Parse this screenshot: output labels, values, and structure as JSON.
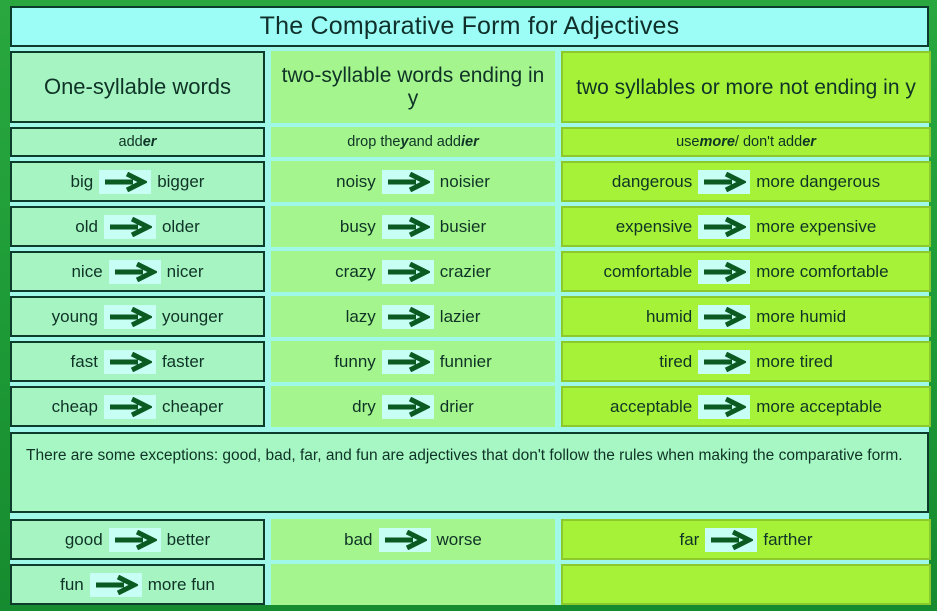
{
  "title": "The Comparative Form for Adjectives",
  "columns": [
    {
      "header": "One-syllable words",
      "rule_parts": [
        "add ",
        "er",
        ""
      ],
      "rows": [
        {
          "base": "big",
          "comparative": "bigger"
        },
        {
          "base": "old",
          "comparative": "older"
        },
        {
          "base": "nice",
          "comparative": "nicer"
        },
        {
          "base": "young",
          "comparative": "younger"
        },
        {
          "base": "fast",
          "comparative": "faster"
        },
        {
          "base": "cheap",
          "comparative": "cheaper"
        }
      ],
      "exception_rows": [
        {
          "base": "good",
          "comparative": "better"
        },
        {
          "base": "fun",
          "comparative": "more fun"
        }
      ]
    },
    {
      "header": "two-syllable words ending in y",
      "rule_parts": [
        "drop the ",
        "y",
        " and add ",
        "ier"
      ],
      "rows": [
        {
          "base": "noisy",
          "comparative": "noisier"
        },
        {
          "base": "busy",
          "comparative": "busier"
        },
        {
          "base": "crazy",
          "comparative": "crazier"
        },
        {
          "base": "lazy",
          "comparative": "lazier"
        },
        {
          "base": "funny",
          "comparative": "funnier"
        },
        {
          "base": "dry",
          "comparative": "drier"
        }
      ],
      "exception_rows": [
        {
          "base": "bad",
          "comparative": "worse"
        },
        {
          "base": "",
          "comparative": ""
        }
      ]
    },
    {
      "header": "two syllables or more not ending in y",
      "rule_parts": [
        "use ",
        "more",
        " / don't add ",
        "er"
      ],
      "rows": [
        {
          "base": "dangerous",
          "comparative": "more dangerous"
        },
        {
          "base": "expensive",
          "comparative": "more expensive"
        },
        {
          "base": "comfortable",
          "comparative": "more comfortable"
        },
        {
          "base": "humid",
          "comparative": "more humid"
        },
        {
          "base": "tired",
          "comparative": "more tired"
        },
        {
          "base": "acceptable",
          "comparative": "more acceptable"
        }
      ],
      "exception_rows": [
        {
          "base": "far",
          "comparative": "farther"
        },
        {
          "base": "",
          "comparative": ""
        }
      ]
    }
  ],
  "note": "There are some exceptions: good, bad, far, and fun are adjectives that don't follow the rules when making the comparative form.",
  "icons": {
    "arrow": "arrow-right-icon"
  },
  "colors": {
    "frame_green": "#21a03c",
    "title_cyan": "#9bfdf5",
    "page_cyan": "#9ff8e8",
    "col1_mint": "#a6f4c2",
    "col2_green": "#a4f58e",
    "col3_lime": "#a6f238",
    "arrow_dark_green": "#0a5a22",
    "arrow_highlight": "#c8fff4",
    "text_dark": "#0f3326"
  }
}
